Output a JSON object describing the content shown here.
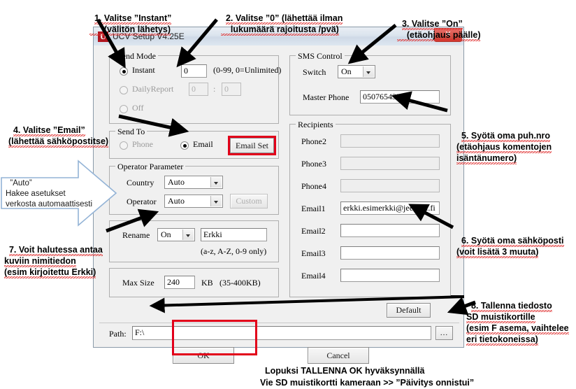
{
  "window": {
    "title": "UCV Setup V4.25E",
    "app_icon": "U",
    "close_label": "✕"
  },
  "send_mode": {
    "group_title": "Send Mode",
    "instant_label": "Instant",
    "instant_value": "0",
    "instant_hint": "(0-99, 0=Unlimited)",
    "dailyreport_label": "DailyReport",
    "dailyreport_hour": "0",
    "dailyreport_colon": ":",
    "dailyreport_min": "0",
    "off_label": "Off"
  },
  "send_to": {
    "group_title": "Send To",
    "phone_label": "Phone",
    "email_label": "Email",
    "email_set_button": "Email Set"
  },
  "operator_parameter": {
    "group_title": "Operator Parameter",
    "country_label": "Country",
    "country_value": "Auto",
    "operator_label": "Operator",
    "operator_value": "Auto",
    "custom_button": "Custom"
  },
  "rename": {
    "label": "Rename",
    "mode_value": "On",
    "name_value": "Erkki",
    "hint": "(a-z, A-Z, 0-9 only)"
  },
  "max_size": {
    "label": "Max Size",
    "value": "240",
    "unit": "KB",
    "hint": "(35-400KB)"
  },
  "sms_control": {
    "group_title": "SMS Control",
    "switch_label": "Switch",
    "switch_value": "On",
    "master_phone_label": "Master Phone",
    "master_phone_value": "0507654321"
  },
  "recipients": {
    "group_title": "Recipients",
    "rows": [
      {
        "label": "Phone2",
        "value": "",
        "disabled": true
      },
      {
        "label": "Phone3",
        "value": "",
        "disabled": true
      },
      {
        "label": "Phone4",
        "value": "",
        "disabled": true
      },
      {
        "label": "Email1",
        "value": "erkki.esimerkki@jeemail.fi",
        "disabled": false
      },
      {
        "label": "Email2",
        "value": "",
        "disabled": false
      },
      {
        "label": "Email3",
        "value": "",
        "disabled": false
      },
      {
        "label": "Email4",
        "value": "",
        "disabled": false
      }
    ]
  },
  "footer": {
    "default_button": "Default",
    "path_label": "Path:",
    "path_value": "F:\\",
    "browse_button": "...",
    "ok_button": "OK",
    "cancel_button": "Cancel"
  },
  "annotations": {
    "a1": "1. Valitse ”Instant”\n      (välitön lähetys)",
    "a2": "2. Valitse ”0” (lähettää ilman\n    lukumäärä rajoitusta /pvä)",
    "a3": "3. Valitse ”On”\n    (etäohjaus päälle)",
    "a4": "4. Valitse ”Email”\n(lähettää sähköpostitse)",
    "a5": "5. Syötä oma puh.nro\n(etäohjaus komentojen\nisäntänumero)",
    "a6": "6. Syötä oma sähköposti\n(voit lisätä 3 muuta)",
    "a7": "7. Voit halutessa antaa\nkuviin nimitiedon\n(esim kirjoitettu Erkki)",
    "a8": "8. Tallenna tiedosto\nSD muistikortille\n(esim F asema, vaihtelee\neri tietokoneissa)",
    "callout": "”Auto”\nHakee asetukset\nverkosta automaattisesti",
    "bottom": "Lopuksi TALLENNA OK hyväksynnällä\nVie SD muistikortti kameraan >> ”Päivitys onnistui”"
  },
  "colors": {
    "highlight_red": "#e2001a",
    "title_bar": "#dbe4ee",
    "dialog_face": "#f0f0f0",
    "close_red": "#c93b2e"
  }
}
